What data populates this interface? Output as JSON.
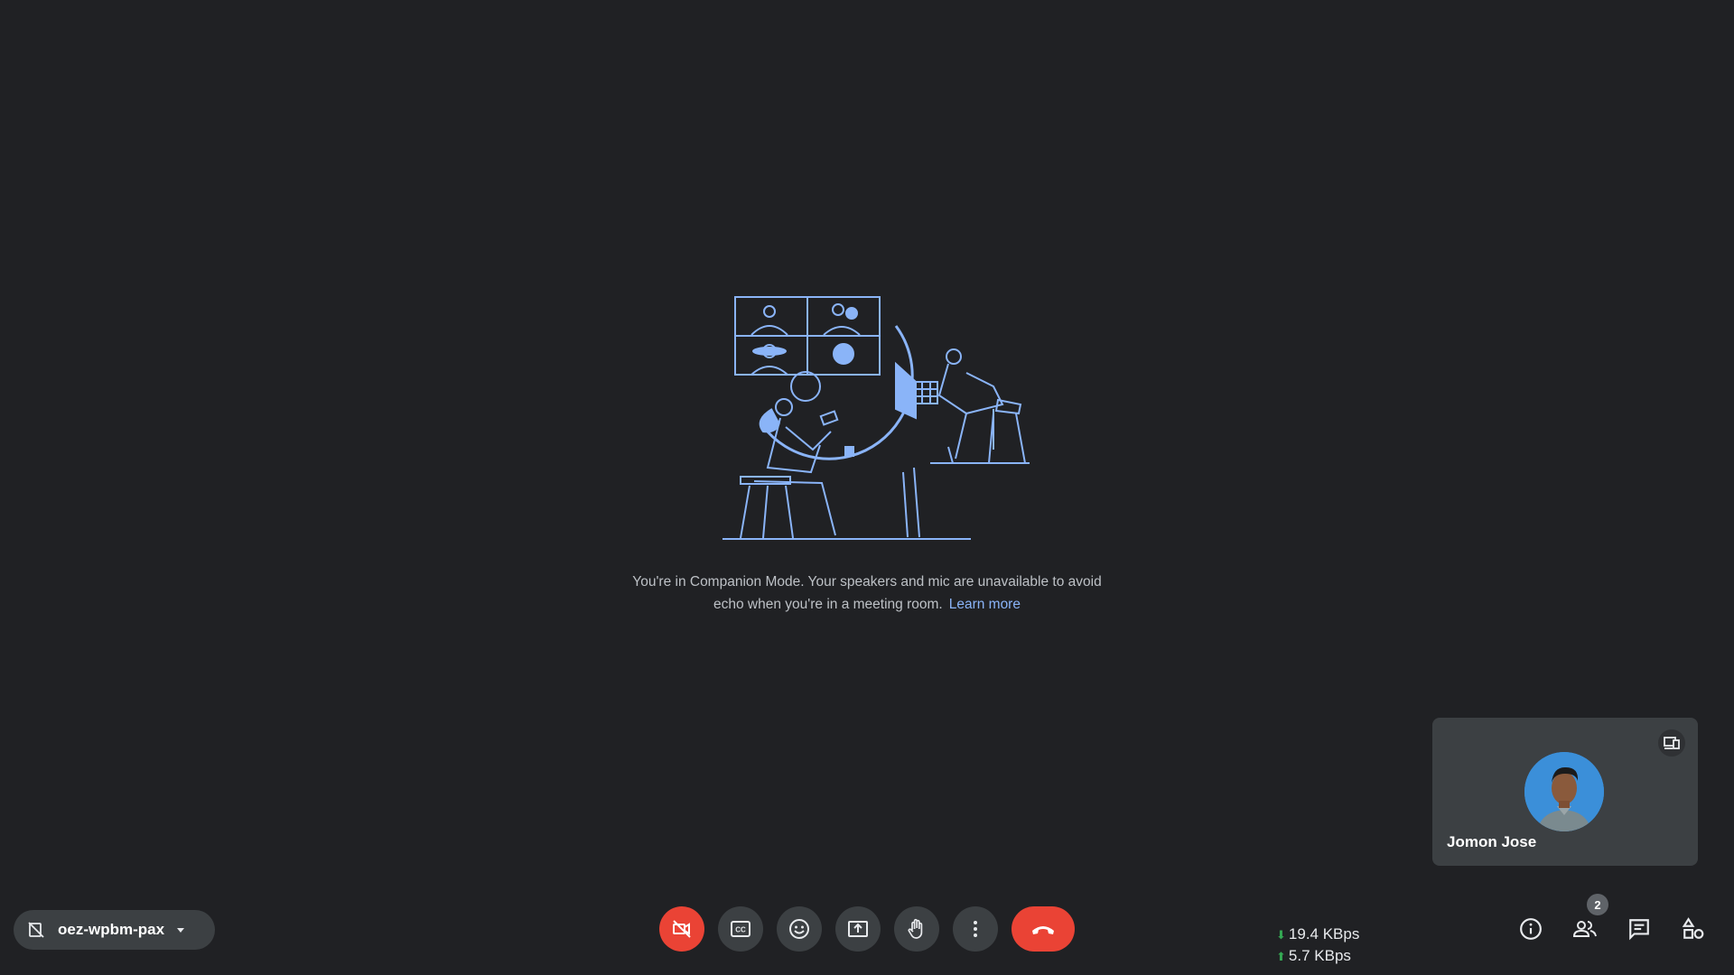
{
  "message": {
    "text": "You're in Companion Mode. Your speakers and mic are unavailable to avoid echo when you're in a meeting room.",
    "link": "Learn more"
  },
  "self_tile": {
    "name": "Jomon Jose"
  },
  "meeting": {
    "code": "oez-wpbm-pax"
  },
  "controls": [
    {
      "name": "camera-off-button",
      "icon": "videocam-off-icon",
      "active_color": "#ea4335"
    },
    {
      "name": "captions-button",
      "icon": "closed-captions-icon"
    },
    {
      "name": "reactions-button",
      "icon": "emoji-icon"
    },
    {
      "name": "present-button",
      "icon": "present-screen-icon"
    },
    {
      "name": "raise-hand-button",
      "icon": "hand-icon"
    },
    {
      "name": "more-options-button",
      "icon": "more-vert-icon"
    },
    {
      "name": "leave-call-button",
      "icon": "call-end-icon",
      "active_color": "#ea4335"
    }
  ],
  "network": {
    "download": "19.4 KBps",
    "upload": "5.7 KBps"
  },
  "side_buttons": {
    "info_icon": "info-icon",
    "people_icon": "people-icon",
    "people_count": "2",
    "chat_icon": "chat-icon",
    "activities_icon": "activities-icon"
  },
  "colors": {
    "background": "#202124",
    "tile": "#3c4043",
    "accent_link": "#8ab4f8",
    "danger": "#ea4335",
    "net_arrow": "#34a853"
  }
}
